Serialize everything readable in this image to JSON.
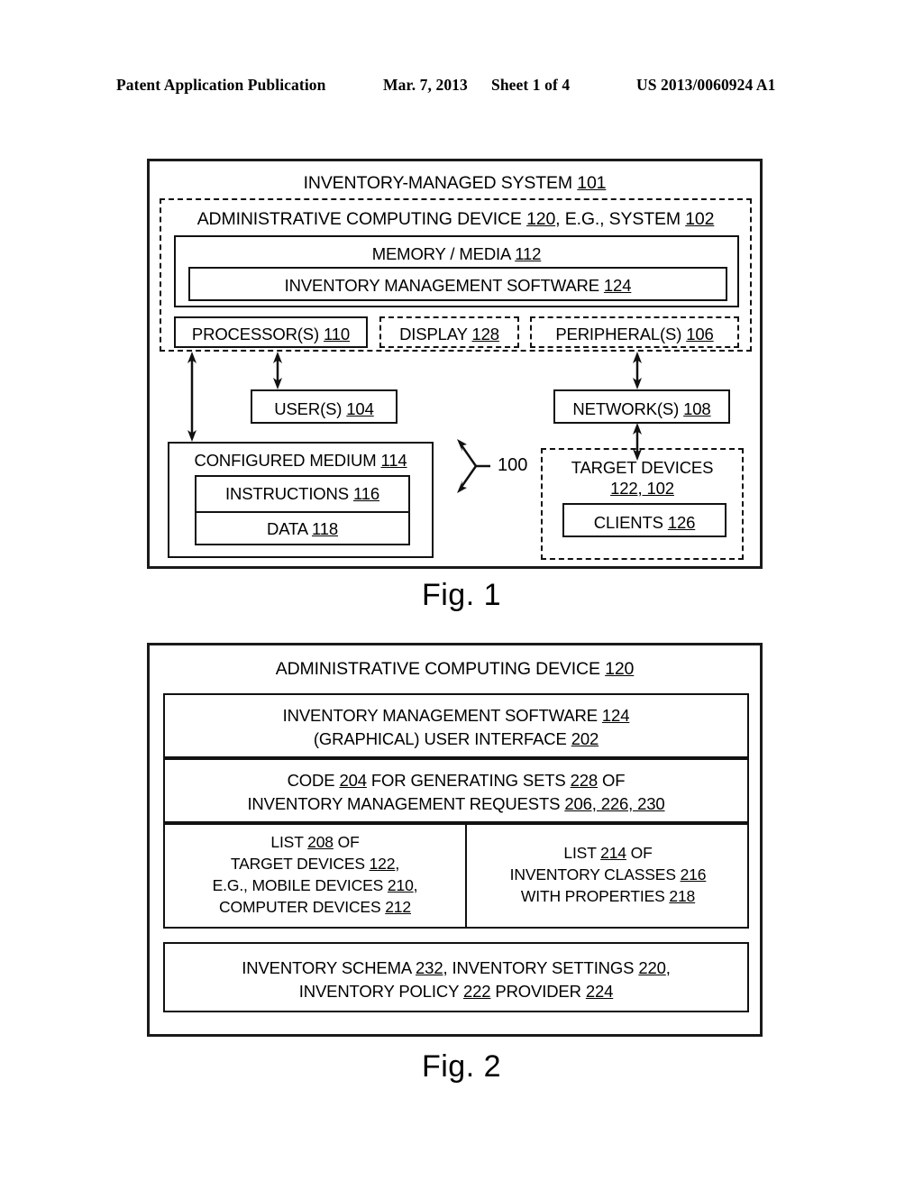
{
  "header": {
    "publication": "Patent Application Publication",
    "date": "Mar. 7, 2013",
    "sheet": "Sheet 1 of 4",
    "doc_number": "US 2013/0060924 A1"
  },
  "figure1": {
    "caption": "Fig. 1",
    "callout": "100",
    "system_title": "INVENTORY-MANAGED SYSTEM",
    "system_ref": "101",
    "admin_device_label": "ADMINISTRATIVE COMPUTING DEVICE",
    "admin_device_ref": "120",
    "admin_device_eg": ", E.G., SYSTEM",
    "admin_device_eg_ref": "102",
    "memory_label": "MEMORY / MEDIA",
    "memory_ref": "112",
    "software_label": "INVENTORY MANAGEMENT SOFTWARE",
    "software_ref": "124",
    "processor_label": "PROCESSOR(S)",
    "processor_ref": "110",
    "display_label": "DISPLAY",
    "display_ref": "128",
    "peripheral_label": "PERIPHERAL(S)",
    "peripheral_ref": "106",
    "users_label": "USER(S)",
    "users_ref": "104",
    "network_label": "NETWORK(S)",
    "network_ref": "108",
    "configured_medium_label": "CONFIGURED MEDIUM",
    "configured_medium_ref": "114",
    "instructions_label": "INSTRUCTIONS",
    "instructions_ref": "116",
    "data_label": "DATA",
    "data_ref": "118",
    "target_devices_label": "TARGET DEVICES",
    "target_devices_ref": "122, 102",
    "clients_label": "CLIENTS",
    "clients_ref": "126"
  },
  "figure2": {
    "caption": "Fig. 2",
    "admin_device_label": "ADMINISTRATIVE COMPUTING DEVICE",
    "admin_device_ref": "120",
    "software_line1_a": "INVENTORY MANAGEMENT SOFTWARE",
    "software_line1_ref": "124",
    "software_line2_a": "(GRAPHICAL) USER INTERFACE",
    "software_line2_ref": "202",
    "code_line1_a": "CODE",
    "code_line1_ref": "204",
    "code_line1_b": "FOR GENERATING SETS",
    "code_line1_ref2": "228",
    "code_line1_c": "OF",
    "code_line2_a": "INVENTORY MANAGEMENT REQUESTS",
    "code_line2_ref": "206, 226, 230",
    "list208_line1_a": "LIST",
    "list208_line1_ref": "208",
    "list208_line1_b": "OF",
    "list208_line2_a": "TARGET DEVICES",
    "list208_line2_ref": "122",
    "list208_line2_b": ",",
    "list208_line3_a": "E.G., MOBILE DEVICES",
    "list208_line3_ref": "210",
    "list208_line3_b": ",",
    "list208_line4_a": "COMPUTER DEVICES",
    "list208_line4_ref": "212",
    "list214_line1_a": "LIST",
    "list214_line1_ref": "214",
    "list214_line1_b": "OF",
    "list214_line2_a": "INVENTORY CLASSES",
    "list214_line2_ref": "216",
    "list214_line3_a": "WITH PROPERTIES",
    "list214_line3_ref": "218",
    "schema_line1_a": "INVENTORY SCHEMA",
    "schema_line1_ref": "232",
    "schema_line1_b": ", INVENTORY SETTINGS",
    "schema_line1_ref2": "220",
    "schema_line1_c": ",",
    "schema_line2_a": "INVENTORY POLICY",
    "schema_line2_ref": "222",
    "schema_line2_b": "PROVIDER",
    "schema_line2_ref2": "224"
  }
}
